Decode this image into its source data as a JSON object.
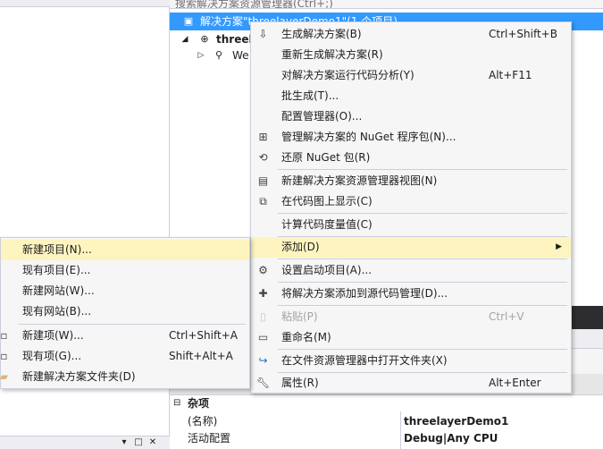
{
  "search": {
    "placeholder": "搜索解决方案资源管理器(Ctrl+;)"
  },
  "tree": {
    "solution_label": "解决方案\"threelayerDemo1\"(1 个项目)",
    "project_label": "threel",
    "child_label": "We"
  },
  "main_menu": {
    "items": [
      {
        "label": "生成解决方案(B)",
        "shortcut": "Ctrl+Shift+B",
        "icon": "build-icon"
      },
      {
        "label": "重新生成解决方案(R)",
        "shortcut": ""
      },
      {
        "label": "对解决方案运行代码分析(Y)",
        "shortcut": "Alt+F11"
      },
      {
        "label": "批生成(T)...",
        "shortcut": ""
      },
      {
        "label": "配置管理器(O)...",
        "shortcut": ""
      },
      {
        "label": "管理解决方案的 NuGet 程序包(N)...",
        "shortcut": "",
        "icon": "nuget-icon"
      },
      {
        "label": "还原 NuGet 包(R)",
        "shortcut": "",
        "icon": "restore-icon"
      },
      {
        "label": "新建解决方案资源管理器视图(N)",
        "shortcut": "",
        "icon": "new-view-icon"
      },
      {
        "label": "在代码图上显示(C)",
        "shortcut": "",
        "icon": "code-map-icon"
      },
      {
        "label": "计算代码度量值(C)",
        "shortcut": ""
      },
      {
        "label": "添加(D)",
        "shortcut": ""
      },
      {
        "label": "设置启动项目(A)...",
        "shortcut": "",
        "icon": "gear-icon"
      },
      {
        "label": "将解决方案添加到源代码管理(D)...",
        "shortcut": "",
        "icon": "source-control-icon"
      },
      {
        "label": "粘贴(P)",
        "shortcut": "Ctrl+V",
        "icon": "paste-icon"
      },
      {
        "label": "重命名(M)",
        "shortcut": "",
        "icon": "rename-icon"
      },
      {
        "label": "在文件资源管理器中打开文件夹(X)",
        "shortcut": "",
        "icon": "open-folder-icon"
      },
      {
        "label": "属性(R)",
        "shortcut": "Alt+Enter",
        "icon": "wrench-icon"
      }
    ]
  },
  "sub_menu": {
    "items": [
      {
        "label": "新建项目(N)...",
        "shortcut": ""
      },
      {
        "label": "现有项目(E)...",
        "shortcut": ""
      },
      {
        "label": "新建网站(W)...",
        "shortcut": ""
      },
      {
        "label": "现有网站(B)...",
        "shortcut": ""
      },
      {
        "label": "新建项(W)...",
        "shortcut": "Ctrl+Shift+A",
        "icon": "new-item-icon"
      },
      {
        "label": "现有项(G)...",
        "shortcut": "Shift+Alt+A",
        "icon": "existing-item-icon"
      },
      {
        "label": "新建解决方案文件夹(D)",
        "shortcut": "",
        "icon": "folder-icon"
      }
    ]
  },
  "properties": {
    "category": "杂项",
    "rows": [
      {
        "key": "(名称)",
        "value": "threelayerDemo1"
      },
      {
        "key": "活动配置",
        "value": "Debug|Any CPU"
      }
    ]
  },
  "colors": {
    "selection": "#3399ff",
    "menu_highlight": "#fdf4bf",
    "menu_bg": "#f6f6f6"
  }
}
